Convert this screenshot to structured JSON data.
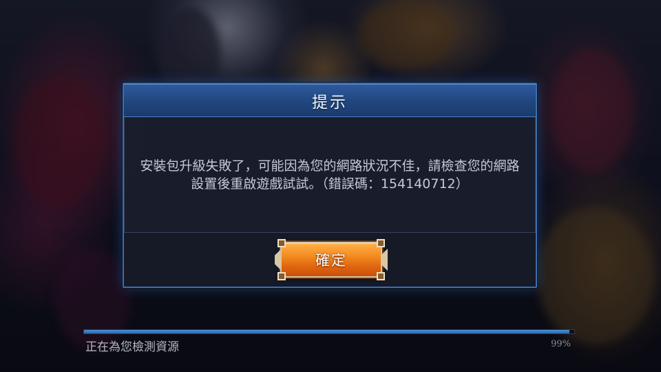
{
  "dialog": {
    "title": "提示",
    "message": "安裝包升級失敗了，可能因為您的網路狀況不佳，請檢查您的網路設置後重啟遊戲試試。（錯誤碼：154140712）",
    "confirm_label": "確定"
  },
  "loading": {
    "status_text": "正在為您檢測資源",
    "percent_text": "99%",
    "progress_fraction": 0.99
  },
  "colors": {
    "dialog_border": "#3c6fae",
    "header_blue": "#21467f",
    "button_orange": "#f28a1f",
    "progress_blue": "#2b66b0"
  }
}
